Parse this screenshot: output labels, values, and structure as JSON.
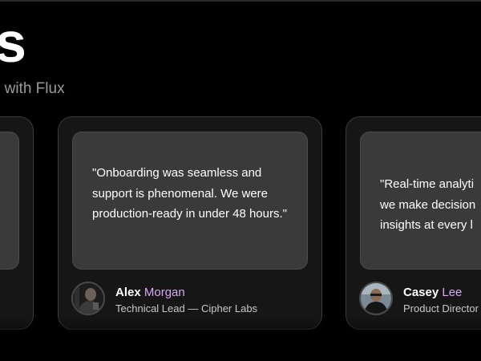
{
  "section": {
    "heading": "s",
    "subtitle": "r with Flux"
  },
  "testimonials": [
    {
      "quote": "",
      "first_name": "",
      "last_name": "",
      "role": ""
    },
    {
      "quote": "\"Onboarding was seamless and support is phenomenal. We were production-ready in under 48 hours.\"",
      "first_name": "Alex",
      "last_name": "Morgan",
      "role": "Technical Lead — Cipher Labs"
    },
    {
      "quote_lines": [
        "\"Real-time analyti",
        "we make decision",
        "insights at every l"
      ],
      "first_name": "Casey",
      "last_name": "Lee",
      "role": "Product Director"
    }
  ],
  "colors": {
    "background": "#000000",
    "card": "#161616",
    "quote_box": "#3a3a3a",
    "accent_last_name": "#d8a8f0"
  }
}
